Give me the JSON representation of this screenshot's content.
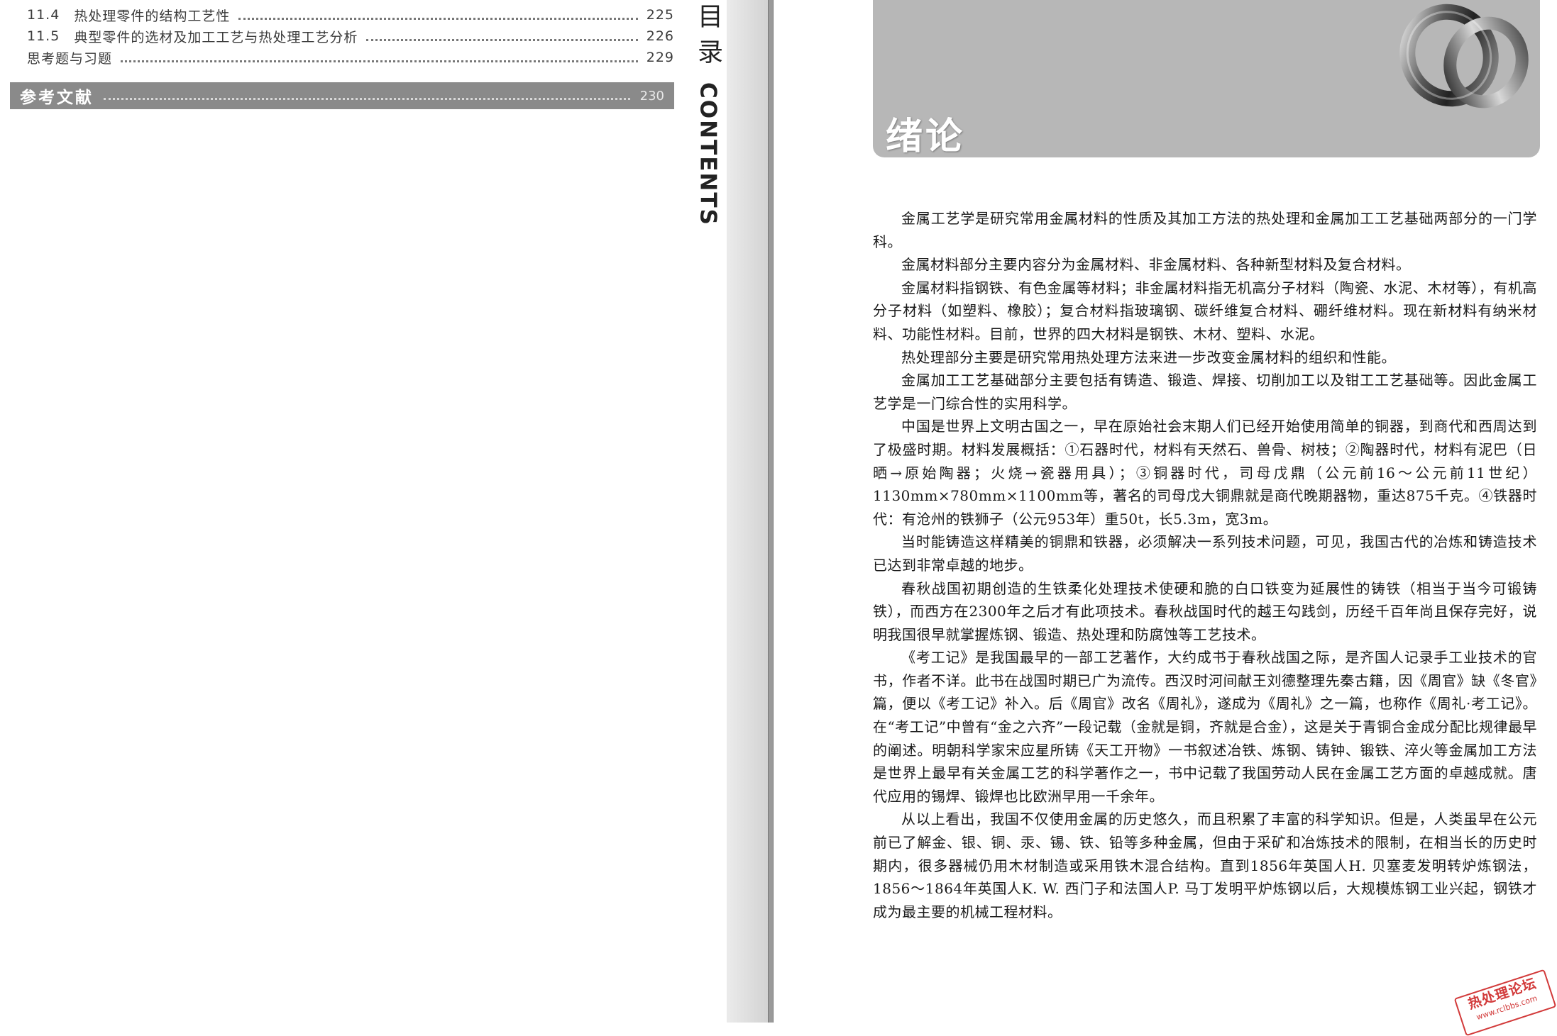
{
  "toc": {
    "entries": [
      {
        "num": "11.4",
        "title": "热处理零件的结构工艺性",
        "page": "225"
      },
      {
        "num": "11.5",
        "title": "典型零件的选材及加工工艺与热处理工艺分析",
        "page": "226"
      },
      {
        "num": "",
        "title": "思考题与习题",
        "page": "229"
      }
    ],
    "references": {
      "title": "参考文献",
      "page": "230"
    },
    "side_label_cn": "目录",
    "side_label_en": "CONTENTS"
  },
  "chapter": {
    "title": "绪论",
    "paragraphs": [
      "金属工艺学是研究常用金属材料的性质及其加工方法的热处理和金属加工工艺基础两部分的一门学科。",
      "金属材料部分主要内容分为金属材料、非金属材料、各种新型材料及复合材料。",
      "金属材料指钢铁、有色金属等材料；非金属材料指无机高分子材料（陶瓷、水泥、木材等），有机高分子材料（如塑料、橡胶）；复合材料指玻璃钢、碳纤维复合材料、硼纤维材料。现在新材料有纳米材料、功能性材料。目前，世界的四大材料是钢铁、木材、塑料、水泥。",
      "热处理部分主要是研究常用热处理方法来进一步改变金属材料的组织和性能。",
      "金属加工工艺基础部分主要包括有铸造、锻造、焊接、切削加工以及钳工工艺基础等。因此金属工艺学是一门综合性的实用科学。",
      "中国是世界上文明古国之一，早在原始社会末期人们已经开始使用简单的铜器，到商代和西周达到了极盛时期。材料发展概括：①石器时代，材料有天然石、兽骨、树枝；②陶器时代，材料有泥巴（日晒→原始陶器；火烧→瓷器用具）；③铜器时代，司母戊鼎（公元前16～公元前11世纪）1130mm×780mm×1100mm等，著名的司母戊大铜鼎就是商代晚期器物，重达875千克。④铁器时代：有沧州的铁狮子（公元953年）重50t，长5.3m，宽3m。",
      "当时能铸造这样精美的铜鼎和铁器，必须解决一系列技术问题，可见，我国古代的冶炼和铸造技术已达到非常卓越的地步。",
      "春秋战国初期创造的生铁柔化处理技术使硬和脆的白口铁变为延展性的铸铁（相当于当今可锻铸铁），而西方在2300年之后才有此项技术。春秋战国时代的越王勾践剑，历经千百年尚且保存完好，说明我国很早就掌握炼钢、锻造、热处理和防腐蚀等工艺技术。",
      "《考工记》是我国最早的一部工艺著作，大约成书于春秋战国之际，是齐国人记录手工业技术的官书，作者不详。此书在战国时期已广为流传。西汉时河间献王刘德整理先秦古籍，因《周官》缺《冬官》篇，便以《考工记》补入。后《周官》改名《周礼》，遂成为《周礼》之一篇，也称作《周礼·考工记》。在“考工记”中曾有“金之六齐”一段记载（金就是铜，齐就是合金），这是关于青铜合金成分配比规律最早的阐述。明朝科学家宋应星所铸《天工开物》一书叙述冶铁、炼钢、铸钟、锻铁、淬火等金属加工方法是世界上最早有关金属工艺的科学著作之一，书中记载了我国劳动人民在金属工艺方面的卓越成就。唐代应用的锡焊、锻焊也比欧洲早用一千余年。",
      "从以上看出，我国不仅使用金属的历史悠久，而且积累了丰富的科学知识。但是，人类虽早在公元前已了解金、银、铜、汞、锡、铁、铅等多种金属，但由于采矿和冶炼技术的限制，在相当长的历史时期内，很多器械仍用木材制造或采用铁木混合结构。直到1856年英国人H. 贝塞麦发明转炉炼钢法，1856～1864年英国人K. W. 西门子和法国人P. 马丁发明平炉炼钢以后，大规模炼钢工业兴起，钢铁才成为最主要的机械工程材料。"
    ]
  },
  "watermark": {
    "main": "热处理论坛",
    "sub": "www.rclbbs.com"
  },
  "colors": {
    "banner": "#b7b7b7",
    "ref_bar": "#8a8a8a",
    "stamp": "#d23a3a"
  }
}
